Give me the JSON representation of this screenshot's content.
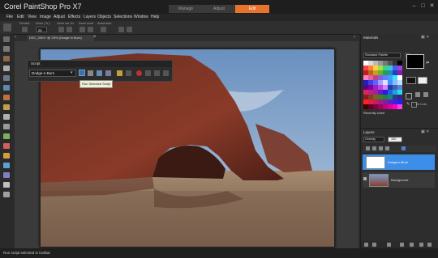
{
  "app": {
    "title": "Corel PaintShop Pro X7",
    "workspace_tabs": [
      "Manage",
      "Adjust",
      "Edit"
    ],
    "active_tab": "Edit"
  },
  "menu": [
    "File",
    "Edit",
    "View",
    "Image",
    "Adjust",
    "Effects",
    "Layers",
    "Objects",
    "Selections",
    "Window",
    "Help"
  ],
  "toolbar": {
    "labels": [
      "Preview",
      "Zoom ( % ):",
      "Zoom out / in:",
      "Zoom more:",
      "Actual size:"
    ],
    "zoom_value": "25"
  },
  "document": {
    "tab_label": "DSC_0001* @ 25% (Dodge in Burn)"
  },
  "script_palette": {
    "title": "Script",
    "selected_script": "Dodge-n-Burn",
    "tooltip": "Run Selected Script"
  },
  "materials": {
    "title": "Materials",
    "palette_select": "Standard Palette",
    "recently_used_label": "Recently Used",
    "all_tools_label": "All tools"
  },
  "layers": {
    "title": "Layers",
    "blend_mode": "Overlay",
    "opacity": "100",
    "items": [
      {
        "name": "Dodge-n-Burn",
        "selected": true
      },
      {
        "name": "Background",
        "selected": false
      }
    ]
  },
  "status": {
    "text": "Run script selected in toolbar"
  },
  "colors": {
    "accent": "#e8732a",
    "selection": "#3d8ee8"
  }
}
